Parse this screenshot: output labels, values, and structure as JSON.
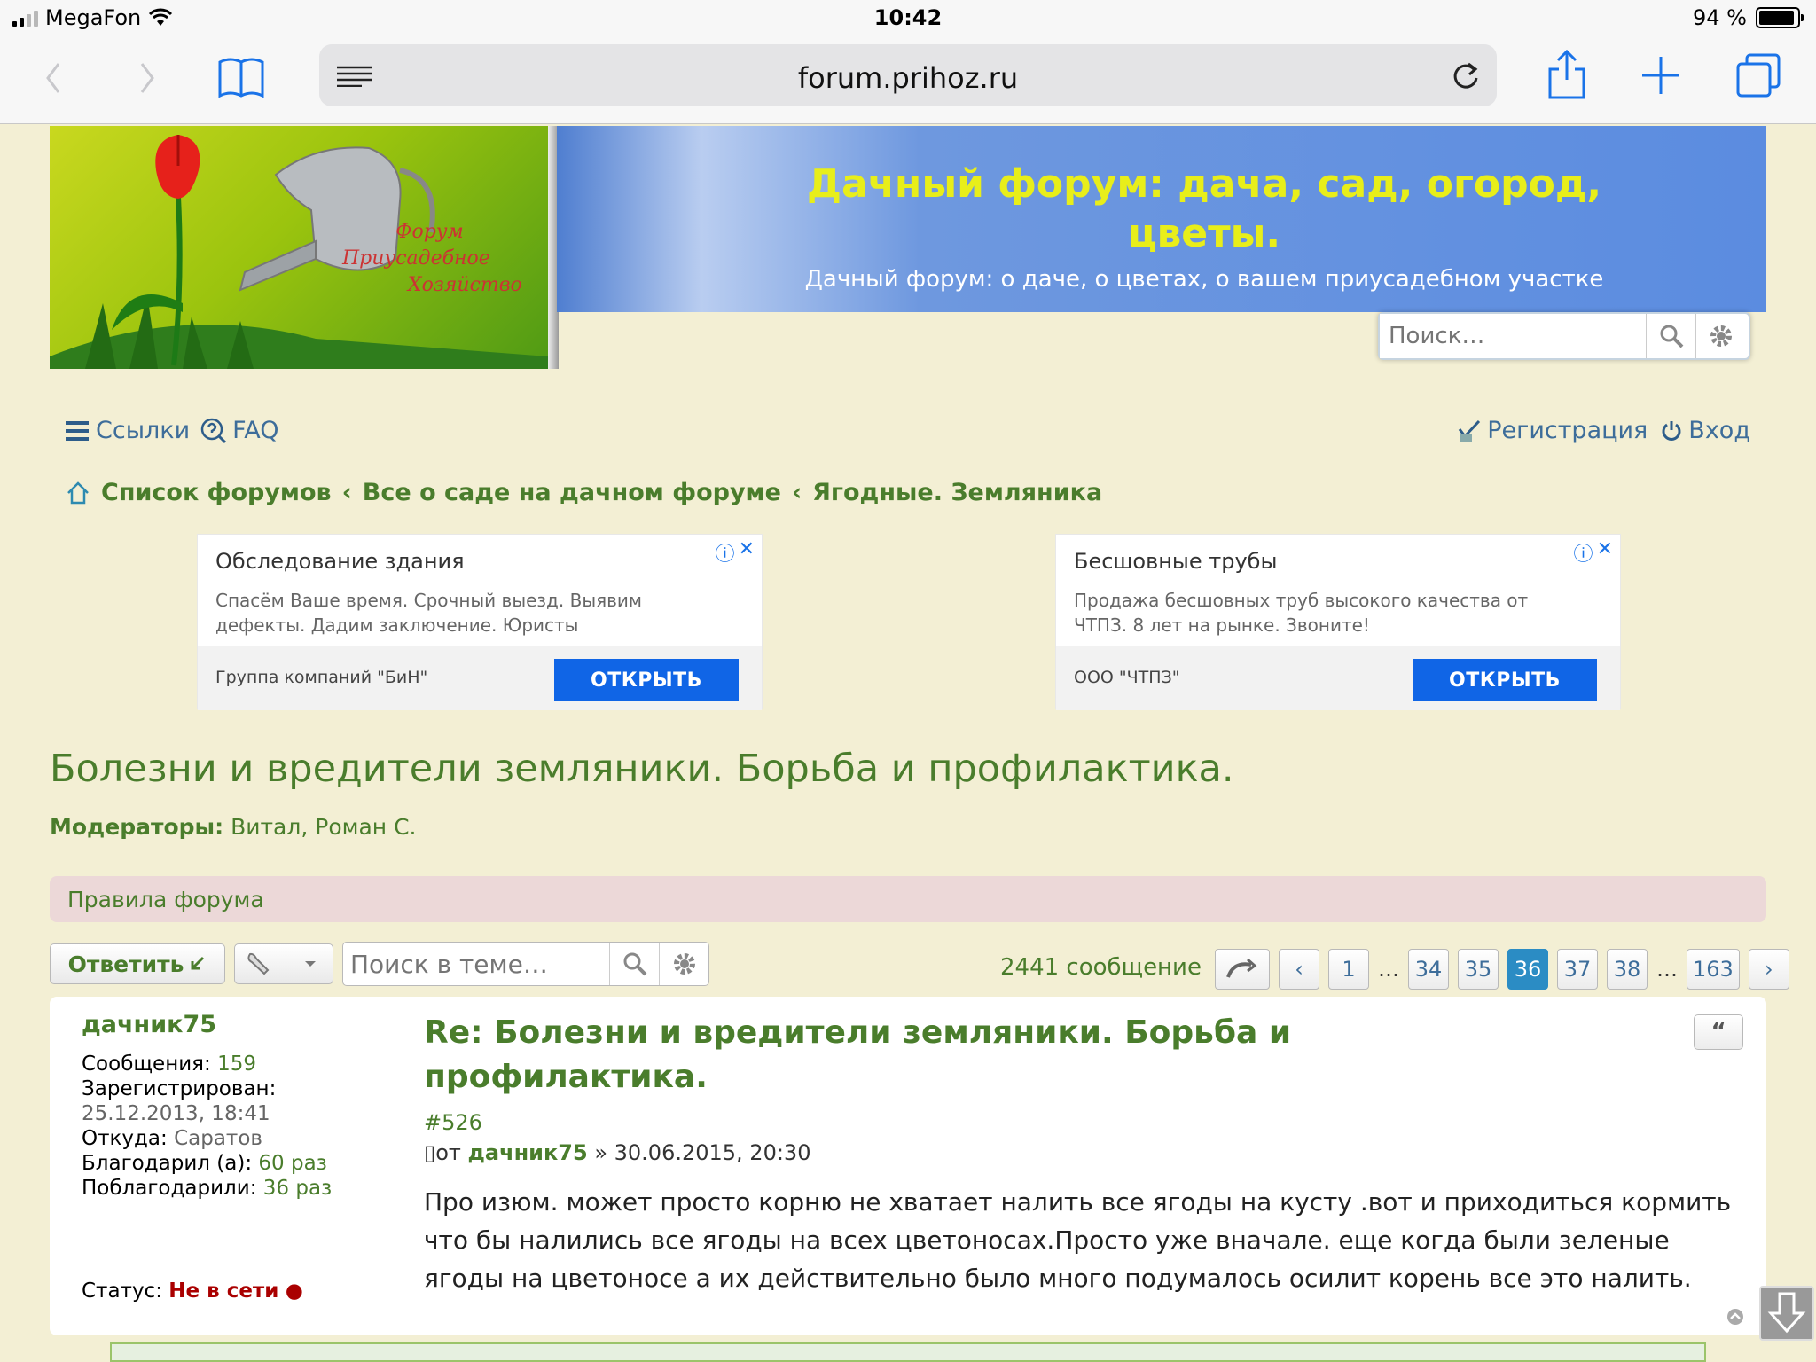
{
  "status_bar": {
    "carrier": "MegaFon",
    "time": "10:42",
    "battery": "94 %",
    "battery_level": 0.94
  },
  "browser": {
    "url": "forum.prihoz.ru"
  },
  "header": {
    "logo_lines": [
      "Форум",
      "Приусадебное",
      "Хозяйство"
    ],
    "title": "Дачный форум: дача, сад, огород, цветы.",
    "subtitle": "Дачный форум: о даче, о цветах, о вашем приусадебном участке",
    "search_placeholder": "Поиск…"
  },
  "nav": {
    "links": "Ссылки",
    "faq": "FAQ",
    "register": "Регистрация",
    "login": "Вход"
  },
  "breadcrumbs": [
    "Список форумов",
    "Все о саде на дачном форуме",
    "Ягодные. Земляника"
  ],
  "ads": [
    {
      "title": "Обследование здания",
      "text": "Спасём Ваше время. Срочный выезд. Выявим дефекты. Дадим заключение. Юристы",
      "company": "Группа компаний \"БиН\"",
      "button": "ОТКРЫТЬ"
    },
    {
      "title": "Бесшовные трубы",
      "text": "Продажа бесшовных труб высокого качества от ЧТПЗ. 8 лет на рынке. Звоните!",
      "company": "ООО \"ЧТПЗ\"",
      "button": "ОТКРЫТЬ"
    }
  ],
  "topic": {
    "title": "Болезни и вредители земляники. Борьба и профилактика.",
    "moderators_label": "Модераторы:",
    "moderators": "Витал, Роман С.",
    "rules": "Правила форума"
  },
  "actions": {
    "reply": "Ответить",
    "search_placeholder": "Поиск в теме…",
    "post_count": "2441 сообщение"
  },
  "pagination": {
    "pages": [
      "1",
      "34",
      "35",
      "36",
      "37",
      "38",
      "163"
    ],
    "current": "36",
    "ellipsis": "…"
  },
  "post": {
    "username": "дачник75",
    "messages_label": "Сообщения:",
    "messages": "159",
    "registered_label": "Зарегистрирован:",
    "registered": "25.12.2013, 18:41",
    "from_label": "Откуда:",
    "from": "Саратов",
    "thanked_label": "Благодарил (а):",
    "thanked": "60 раз",
    "got_thanks_label": "Поблагодарили:",
    "got_thanks": "36 раз",
    "status_label": "Статус:",
    "status": "Не в сети",
    "title": "Re: Болезни и вредители земляники. Борьба и профилактика.",
    "number": "#526",
    "by": "от",
    "author": "дачник75",
    "date": "» 30.06.2015, 20:30",
    "body": "Про изюм. может просто корню не хватает налить все ягоды на кусту .вот и приходиться кормить что бы налились все ягоды на всех цветоносах.Просто уже вначале. еще когда были зеленые ягоды на цветоносе а их действительно было много подумалось осилит корень все это налить."
  }
}
